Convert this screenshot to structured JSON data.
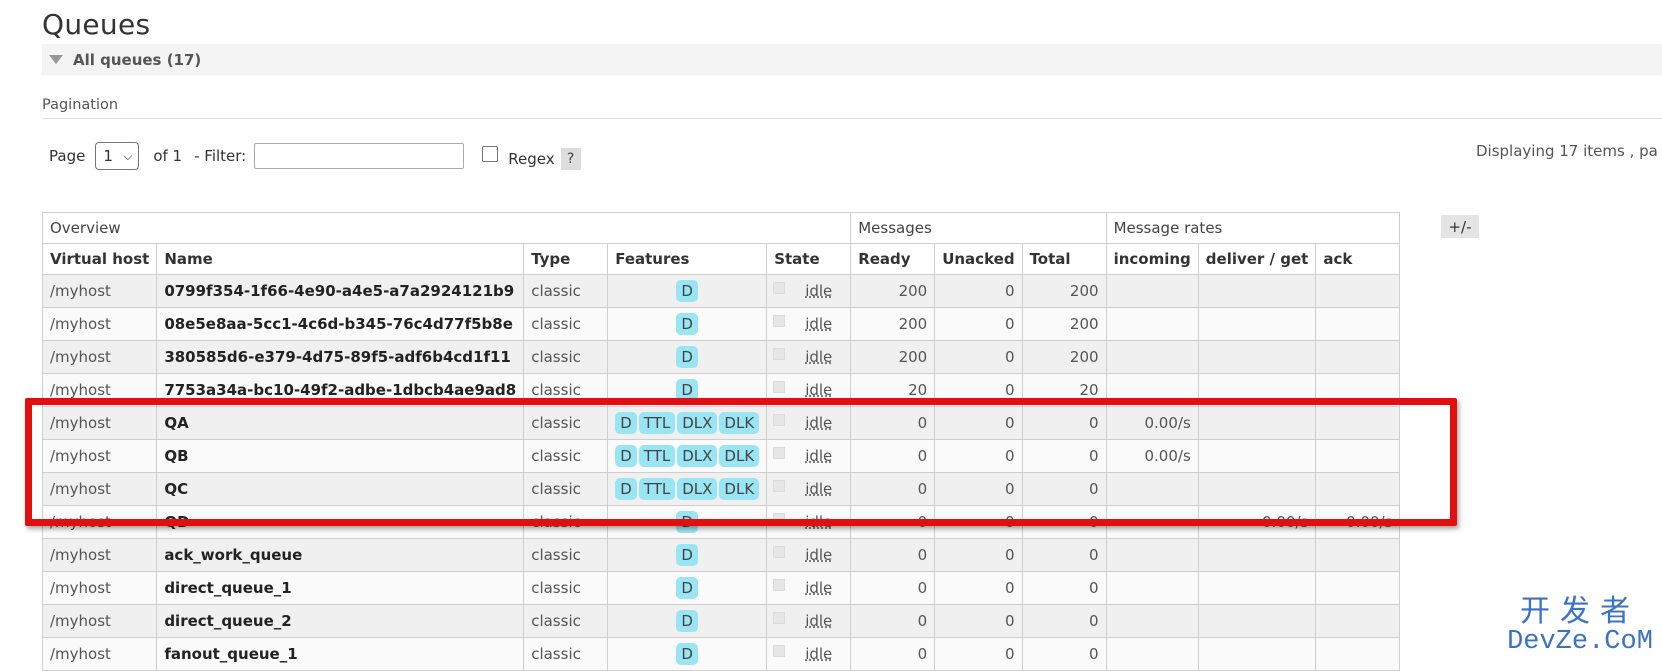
{
  "title": "Queues",
  "section": {
    "label": "All queues (17)"
  },
  "pagination": {
    "label": "Pagination",
    "page_text": "Page",
    "page_value": "1",
    "of_text": "of 1",
    "filter_text": "- Filter:",
    "filter_value": "",
    "regex_label": "Regex",
    "help_label": "?",
    "displaying": "Displaying 17 items , pa"
  },
  "table": {
    "groups": [
      "Overview",
      "Messages",
      "Message rates"
    ],
    "toggle_label": "+/-",
    "columns": [
      "Virtual host",
      "Name",
      "Type",
      "Features",
      "State",
      "Ready",
      "Unacked",
      "Total",
      "incoming",
      "deliver / get",
      "ack"
    ],
    "rows": [
      {
        "vhost": "/myhost",
        "name": "0799f354-1f66-4e90-a4e5-a7a2924121b9",
        "type": "classic",
        "features": [
          "D"
        ],
        "state": "idle",
        "ready": "200",
        "unacked": "0",
        "total": "200",
        "incoming": "",
        "deliver": "",
        "ack": ""
      },
      {
        "vhost": "/myhost",
        "name": "08e5e8aa-5cc1-4c6d-b345-76c4d77f5b8e",
        "type": "classic",
        "features": [
          "D"
        ],
        "state": "idle",
        "ready": "200",
        "unacked": "0",
        "total": "200",
        "incoming": "",
        "deliver": "",
        "ack": ""
      },
      {
        "vhost": "/myhost",
        "name": "380585d6-e379-4d75-89f5-adf6b4cd1f11",
        "type": "classic",
        "features": [
          "D"
        ],
        "state": "idle",
        "ready": "200",
        "unacked": "0",
        "total": "200",
        "incoming": "",
        "deliver": "",
        "ack": ""
      },
      {
        "vhost": "/myhost",
        "name": "7753a34a-bc10-49f2-adbe-1dbcb4ae9ad8",
        "type": "classic",
        "features": [
          "D"
        ],
        "state": "idle",
        "ready": "20",
        "unacked": "0",
        "total": "20",
        "incoming": "",
        "deliver": "",
        "ack": ""
      },
      {
        "vhost": "/myhost",
        "name": "QA",
        "type": "classic",
        "features": [
          "D",
          "TTL",
          "DLX",
          "DLK"
        ],
        "state": "idle",
        "ready": "0",
        "unacked": "0",
        "total": "0",
        "incoming": "0.00/s",
        "deliver": "",
        "ack": ""
      },
      {
        "vhost": "/myhost",
        "name": "QB",
        "type": "classic",
        "features": [
          "D",
          "TTL",
          "DLX",
          "DLK"
        ],
        "state": "idle",
        "ready": "0",
        "unacked": "0",
        "total": "0",
        "incoming": "0.00/s",
        "deliver": "",
        "ack": ""
      },
      {
        "vhost": "/myhost",
        "name": "QC",
        "type": "classic",
        "features": [
          "D",
          "TTL",
          "DLX",
          "DLK"
        ],
        "state": "idle",
        "ready": "0",
        "unacked": "0",
        "total": "0",
        "incoming": "",
        "deliver": "",
        "ack": ""
      },
      {
        "vhost": "/myhost",
        "name": "QD",
        "type": "classic",
        "features": [
          "D"
        ],
        "state": "idle",
        "ready": "0",
        "unacked": "0",
        "total": "0",
        "incoming": "",
        "deliver": "0.00/s",
        "ack": "0.00/s"
      },
      {
        "vhost": "/myhost",
        "name": "ack_work_queue",
        "type": "classic",
        "features": [
          "D"
        ],
        "state": "idle",
        "ready": "0",
        "unacked": "0",
        "total": "0",
        "incoming": "",
        "deliver": "",
        "ack": ""
      },
      {
        "vhost": "/myhost",
        "name": "direct_queue_1",
        "type": "classic",
        "features": [
          "D"
        ],
        "state": "idle",
        "ready": "0",
        "unacked": "0",
        "total": "0",
        "incoming": "",
        "deliver": "",
        "ack": ""
      },
      {
        "vhost": "/myhost",
        "name": "direct_queue_2",
        "type": "classic",
        "features": [
          "D"
        ],
        "state": "idle",
        "ready": "0",
        "unacked": "0",
        "total": "0",
        "incoming": "",
        "deliver": "",
        "ack": ""
      },
      {
        "vhost": "/myhost",
        "name": "fanout_queue_1",
        "type": "classic",
        "features": [
          "D"
        ],
        "state": "idle",
        "ready": "0",
        "unacked": "0",
        "total": "0",
        "incoming": "",
        "deliver": "",
        "ack": ""
      }
    ]
  },
  "annotation": {
    "highlight_color": "#e10f10"
  },
  "watermark": {
    "cn": "开发者",
    "en": "DevZe.CoM"
  }
}
